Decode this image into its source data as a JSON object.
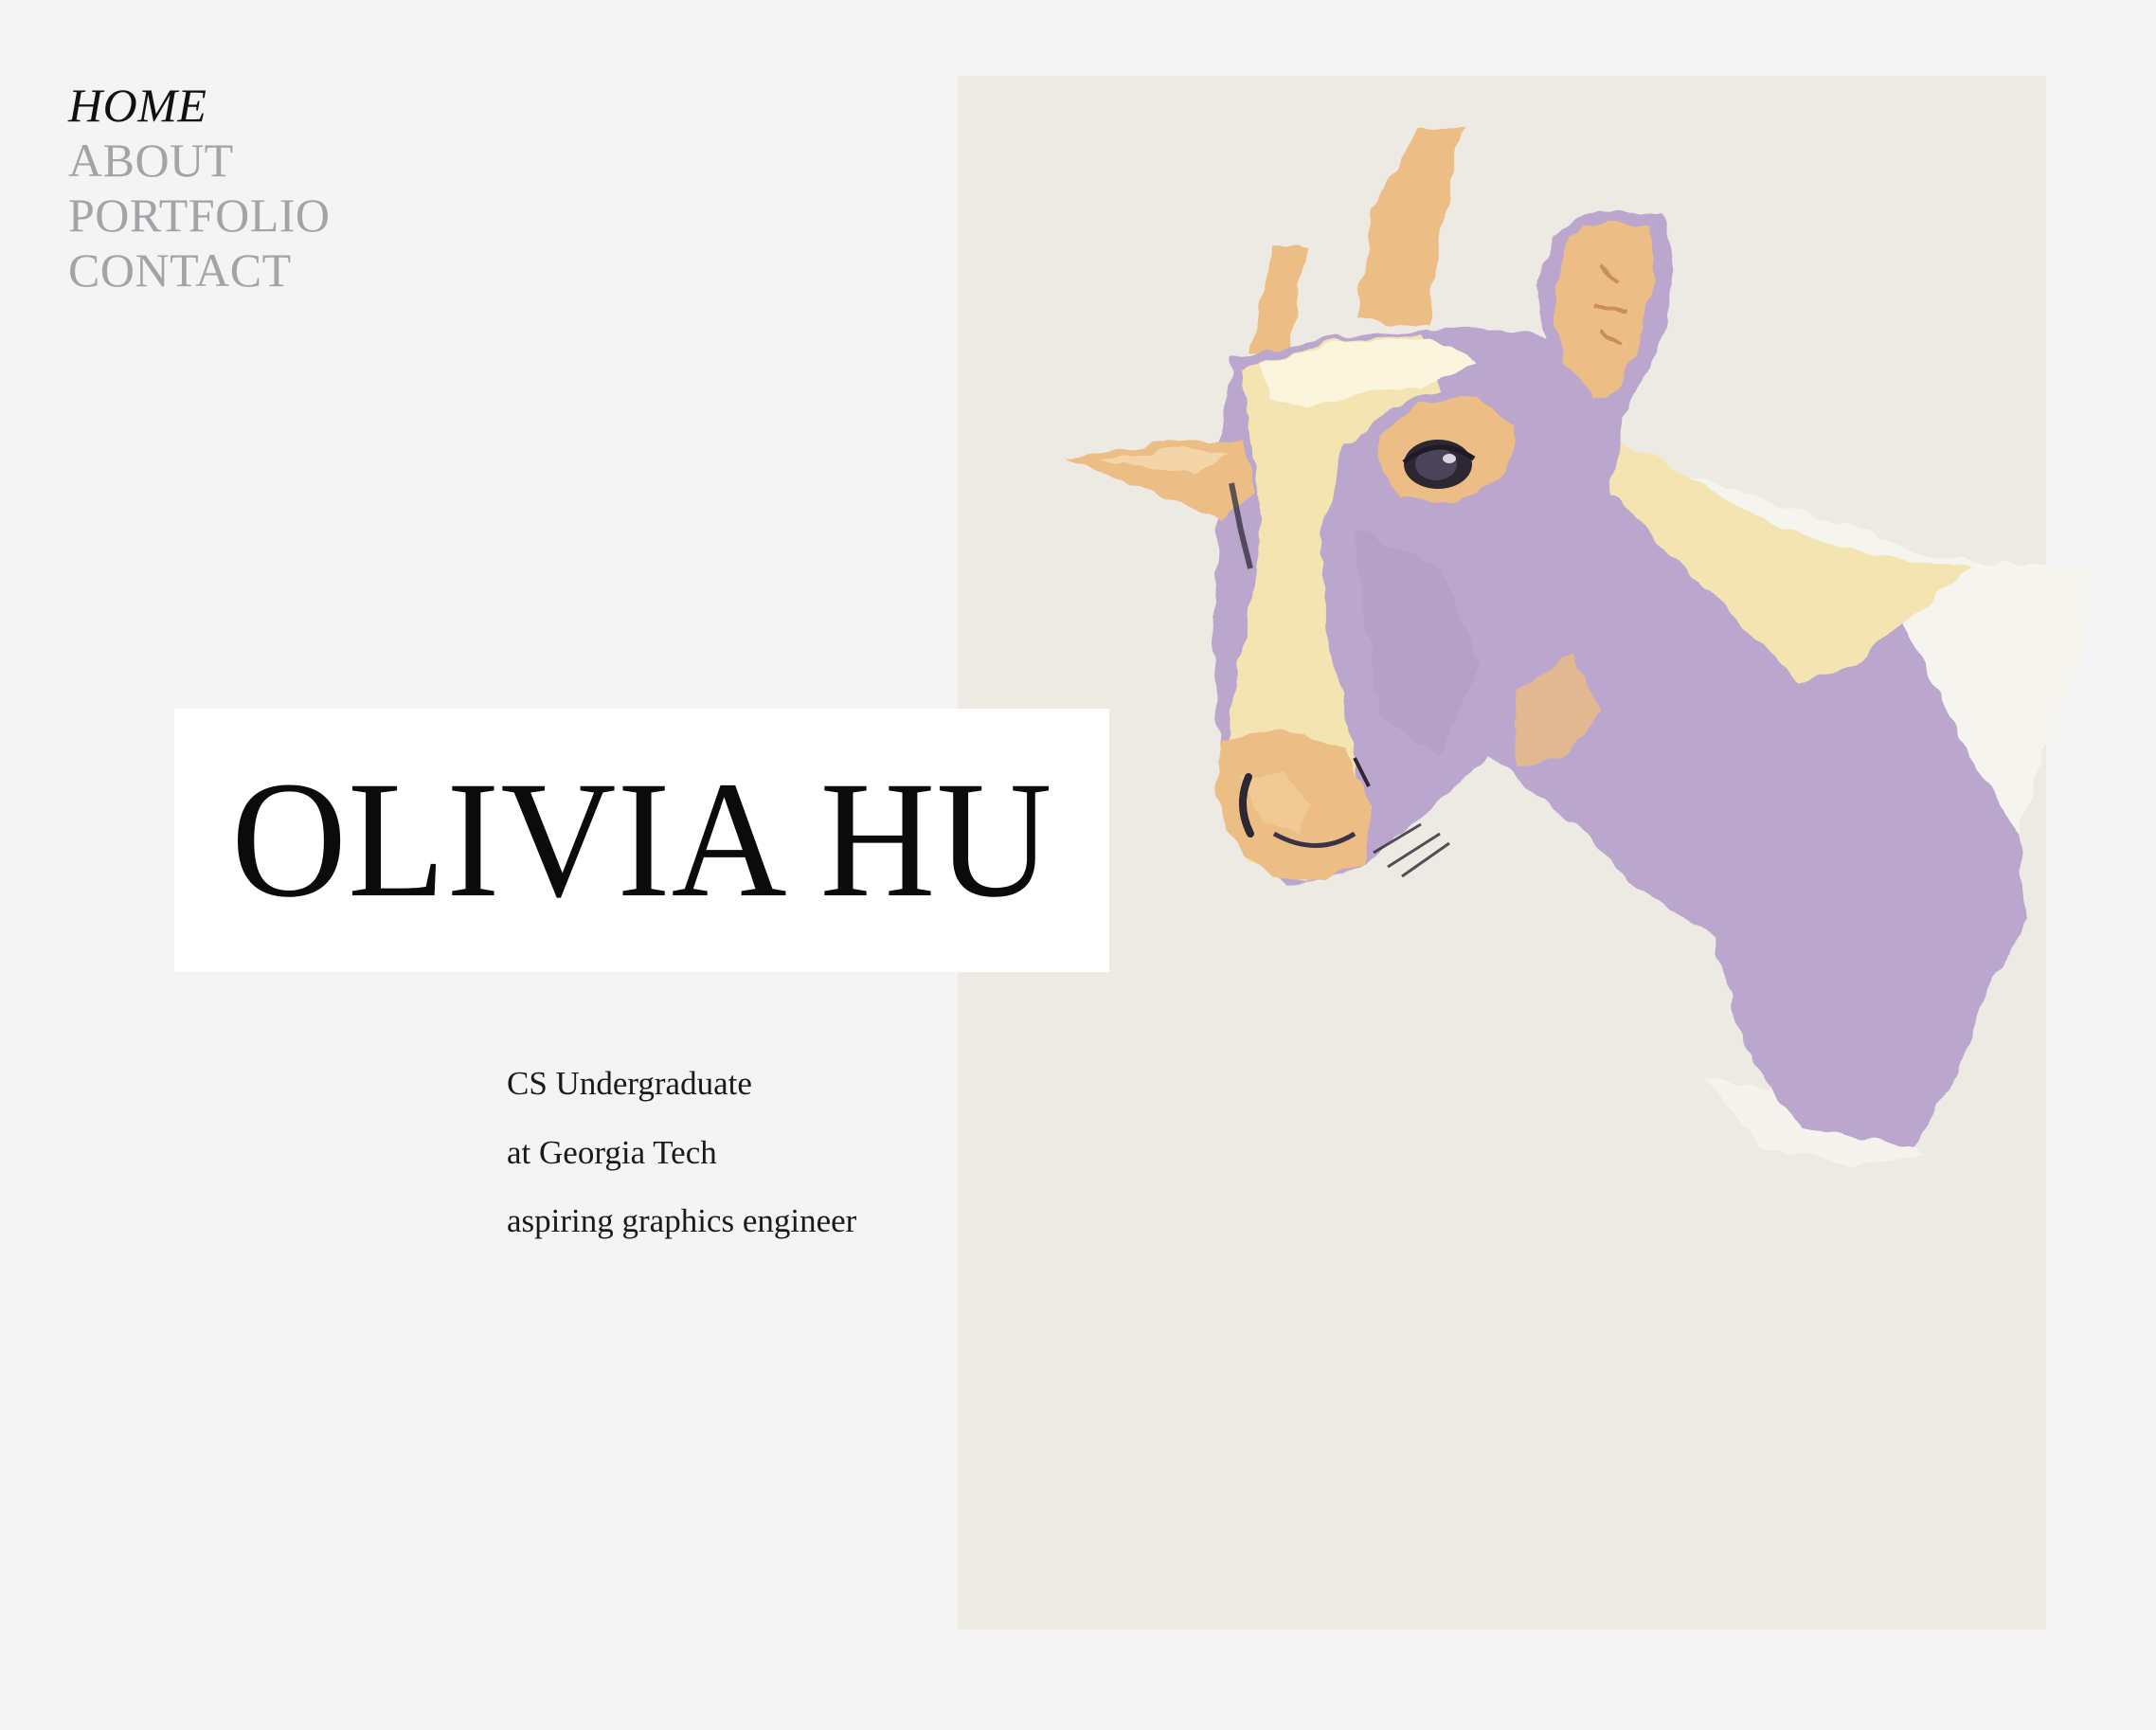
{
  "nav": {
    "items": [
      {
        "label": "HOME",
        "active": true
      },
      {
        "label": "ABOUT",
        "active": false
      },
      {
        "label": "PORTFOLIO",
        "active": false
      },
      {
        "label": "CONTACT",
        "active": false
      }
    ]
  },
  "hero": {
    "name": "OLIVIA HU",
    "tagline": [
      "CS Undergraduate",
      "at Georgia Tech",
      "aspiring graphics engineer"
    ]
  },
  "artwork": {
    "subject": "goat-illustration",
    "colors": {
      "panel": "#edeae4",
      "lavender": "#bba7cd",
      "cream": "#f3e4b2",
      "peach": "#ecbd84",
      "dark": "#2c2733"
    }
  },
  "theme": {
    "background": "#f4f4f4",
    "nav_inactive": "#a3a3a8",
    "nav_active": "#111111"
  }
}
